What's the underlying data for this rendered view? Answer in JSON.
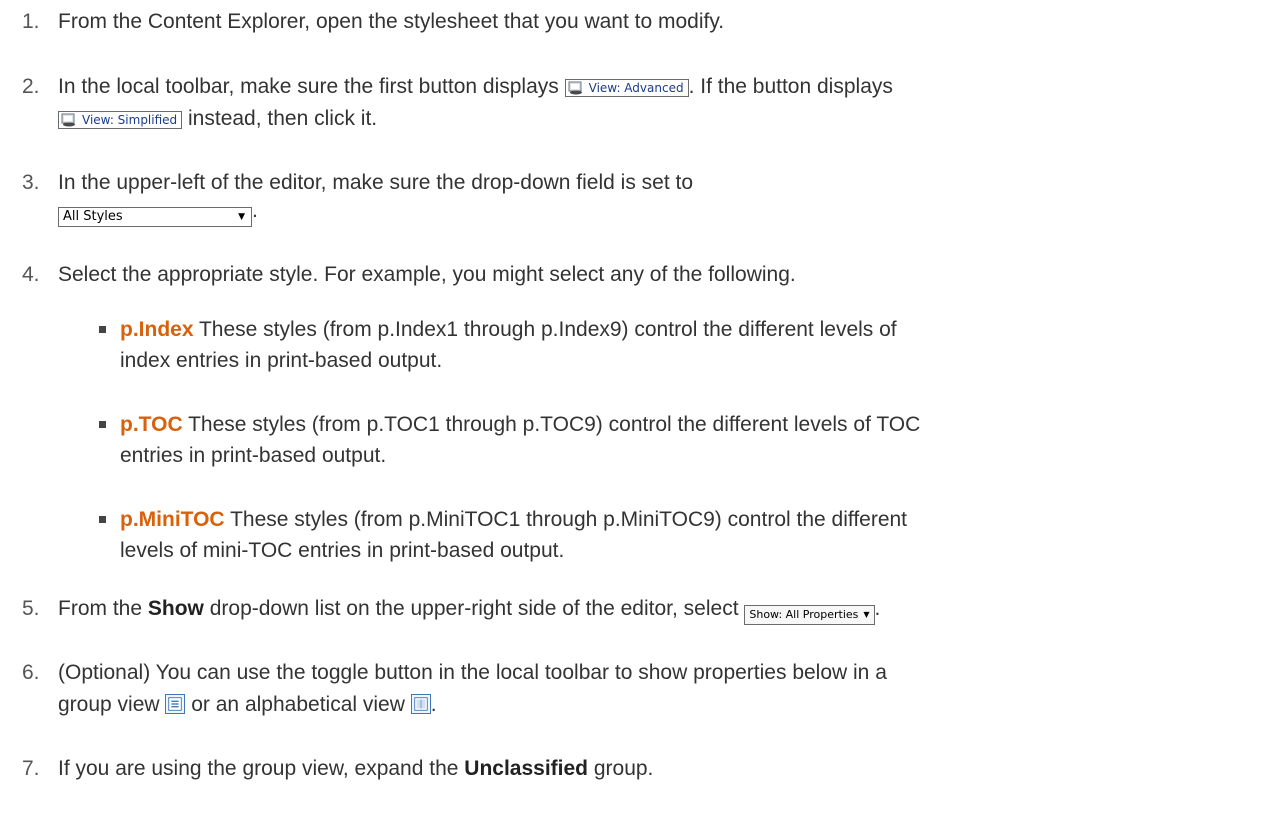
{
  "steps": [
    {
      "num": "1.",
      "text": "From the Content Explorer, open the stylesheet that you want to modify."
    },
    {
      "num": "2.",
      "text_a": "In the local toolbar, make sure the first button displays",
      "btn_a": "View: Advanced",
      "text_b": ". If the button displays",
      "btn_b": "View: Simplified",
      "text_c": "instead, then click it."
    },
    {
      "num": "3.",
      "text_a": "In the upper-left of the editor, make sure the drop-down field is set to",
      "dropdown_value": "All Styles",
      "text_b": "."
    },
    {
      "num": "4.",
      "text": "Select the appropriate style. For example, you might select any of the following."
    },
    {
      "num": "5.",
      "text_a": "From the",
      "bold": "Show",
      "text_b": "drop-down list on the upper-right side of the editor, select",
      "show_btn": "Show: All Properties",
      "text_c": "."
    },
    {
      "num": "6.",
      "text_a": "(Optional) You can use the toggle button in the local toolbar to show properties below in a",
      "text_b": "group view",
      "text_c": "or an alphabetical view",
      "text_d": "."
    },
    {
      "num": "7.",
      "text_a": "If you are using the group view, expand the",
      "bold": "Unclassified",
      "text_b": "group."
    }
  ],
  "bullets": [
    {
      "term": "p.Index",
      "line1": "These styles (from p.Index1 through p.Index9) control the different levels of",
      "line2": "index entries in print-based output."
    },
    {
      "term": "p.TOC",
      "line1": "These styles (from p.TOC1 through p.TOC9) control the different levels of TOC",
      "line2": "entries in print-based output."
    },
    {
      "term": "p.MiniTOC",
      "line1": "These styles (from p.MiniTOC1 through p.MiniTOC9) control the different",
      "line2": "levels of mini-TOC entries in print-based output."
    }
  ],
  "colors": {
    "term": "#d8610c",
    "text": "#333333"
  },
  "icons": [
    "view-icon",
    "group-view-icon",
    "alphabetical-view-icon",
    "chevron-down-icon"
  ]
}
